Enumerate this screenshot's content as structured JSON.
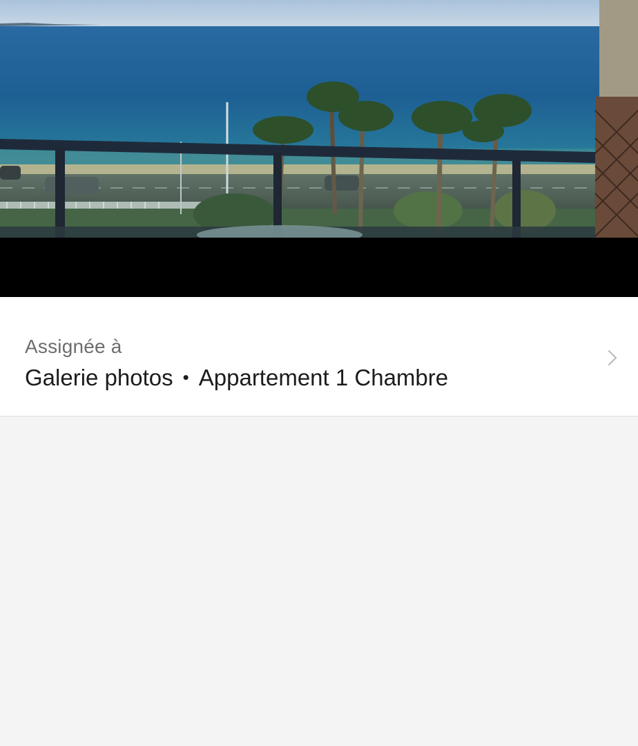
{
  "photo": {
    "subject": "sea-view-balcony-photo"
  },
  "assignment": {
    "label": "Assignée à",
    "gallery": "Galerie photos",
    "separator": "•",
    "room": "Appartement 1 Chambre"
  },
  "icons": {
    "chevron": "chevron-right-icon"
  },
  "colors": {
    "sea": "#1f5f8f",
    "sky": "#b8cde0",
    "row_background": "#ffffff",
    "page_background": "#f4f4f4"
  }
}
